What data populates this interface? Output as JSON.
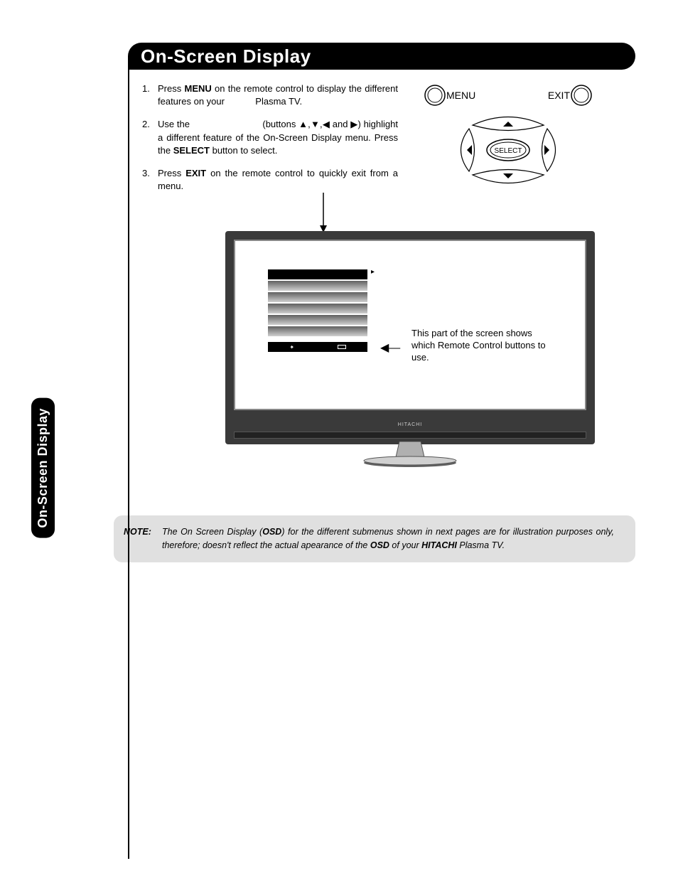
{
  "header": {
    "title": "On-Screen Display"
  },
  "sideTab": {
    "label": "On-Screen Display"
  },
  "steps": [
    {
      "num": "1.",
      "parts": {
        "a": "Press ",
        "b": "MENU",
        "c": " on the remote control to display the different features on your ",
        "d": "Plasma TV."
      }
    },
    {
      "num": "2.",
      "parts": {
        "a": "Use the ",
        "gap": "                         ",
        "b": "(buttons ▲,▼,◀ and ▶) highlight a different feature of the On-Screen Display menu. Press the ",
        "c": "SELECT",
        "d": " button to select."
      }
    },
    {
      "num": "3.",
      "parts": {
        "a": "Press ",
        "b": "EXIT",
        "c": " on the remote control to quickly exit from a menu."
      }
    }
  ],
  "remote": {
    "menuLabel": "MENU",
    "exitLabel": "EXIT",
    "selectLabel": "SELECT"
  },
  "tv": {
    "brand": "HITACHI",
    "callout": "This part of the screen shows which Remote Control buttons to use."
  },
  "note": {
    "label": "NOTE:",
    "parts": {
      "a": "The On Screen Display (",
      "b": "OSD",
      "c": ") for the different submenus shown in next pages are for illustration purposes only, therefore; doesn't reflect the actual apearance of the ",
      "d": "OSD",
      "e": " of your ",
      "f": "HITACHI",
      "g": " Plasma TV."
    }
  }
}
